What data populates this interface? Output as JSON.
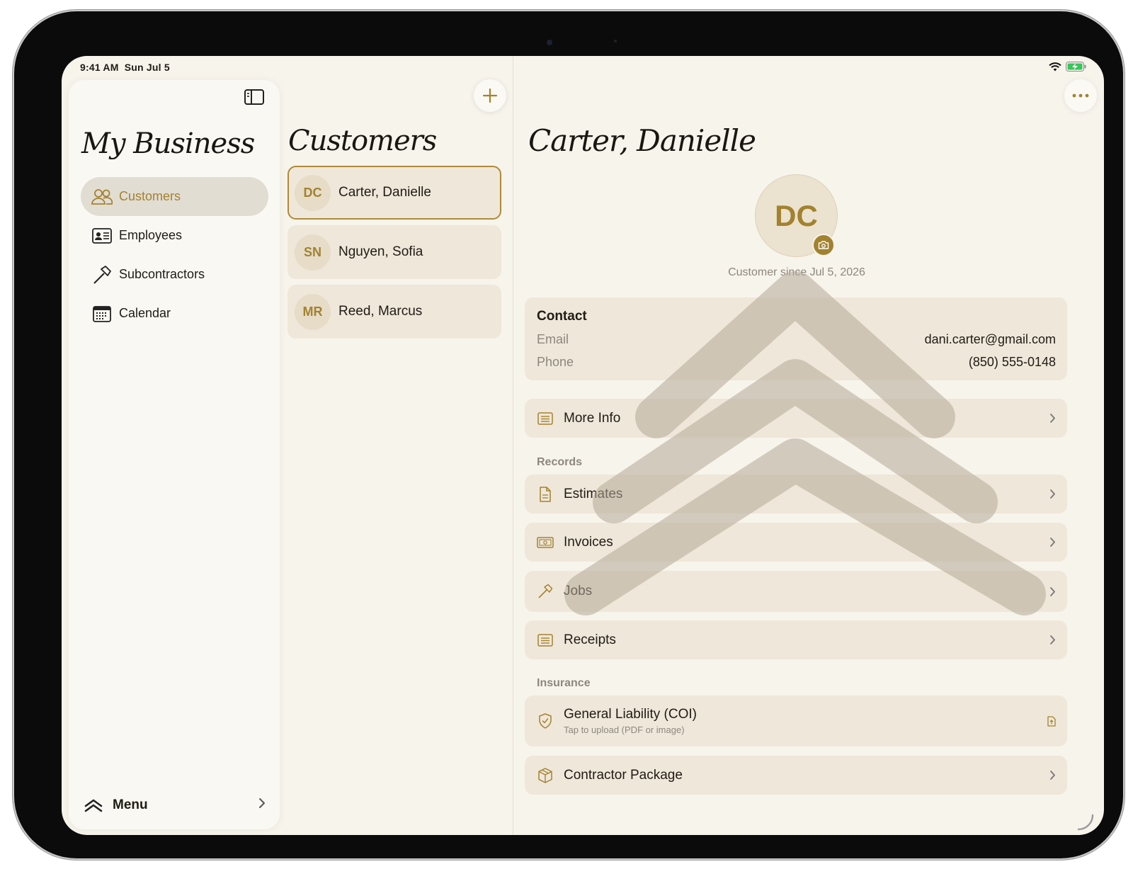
{
  "status": {
    "time": "9:41 AM",
    "date": "Sun Jul 5"
  },
  "sidebar": {
    "title": "My Business",
    "items": [
      {
        "label": "Customers",
        "icon": "people-icon",
        "active": true
      },
      {
        "label": "Employees",
        "icon": "id-card-icon",
        "active": false
      },
      {
        "label": "Subcontractors",
        "icon": "hammer-icon",
        "active": false
      },
      {
        "label": "Calendar",
        "icon": "calendar-icon",
        "active": false
      }
    ],
    "menu_label": "Menu"
  },
  "customers": {
    "title": "Customers",
    "list": [
      {
        "initials": "DC",
        "name": "Carter, Danielle",
        "selected": true
      },
      {
        "initials": "SN",
        "name": "Nguyen, Sofia",
        "selected": false
      },
      {
        "initials": "MR",
        "name": "Reed, Marcus",
        "selected": false
      }
    ]
  },
  "detail": {
    "title": "Carter, Danielle",
    "initials": "DC",
    "since": "Customer since Jul 5, 2026",
    "contact": {
      "heading": "Contact",
      "email_label": "Email",
      "email": "dani.carter@gmail.com",
      "phone_label": "Phone",
      "phone": "(850) 555-0148"
    },
    "more_info": "More Info",
    "records_label": "Records",
    "records": {
      "estimates": "Estimates",
      "invoices": "Invoices",
      "jobs": "Jobs",
      "receipts": "Receipts"
    },
    "insurance_label": "Insurance",
    "insurance": {
      "coi_title": "General Liability (COI)",
      "coi_sub": "Tap to upload (PDF or image)",
      "contractor_package": "Contractor Package"
    }
  },
  "colors": {
    "accent": "#a3822f",
    "background": "#f7f4ec",
    "card": "#efe7d9",
    "selected_border": "#b0893a"
  }
}
